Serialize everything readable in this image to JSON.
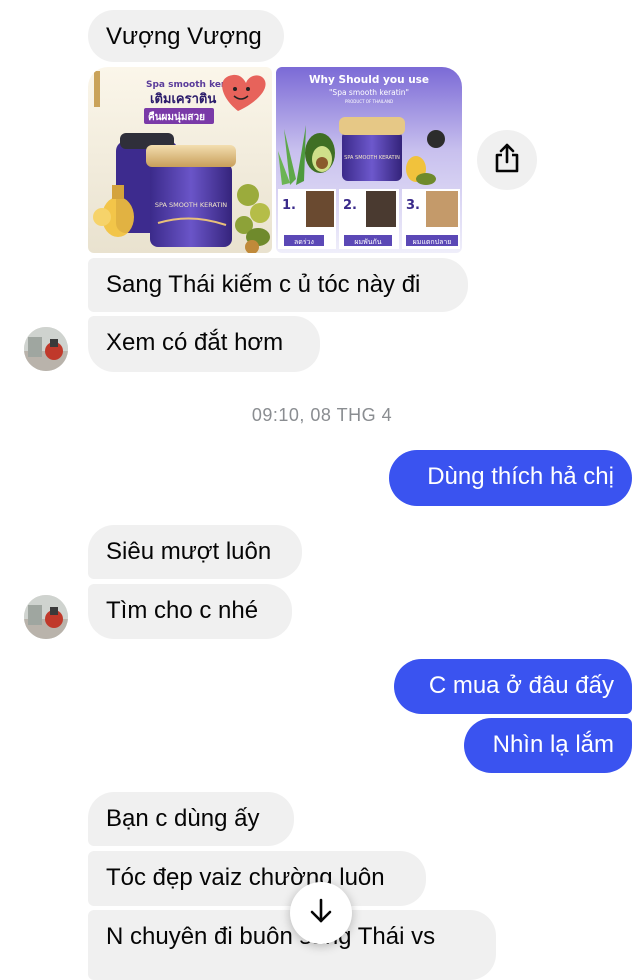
{
  "sender": {
    "name": "Vượng Vượng"
  },
  "images": {
    "left": {
      "headline": "Spa smooth keratin",
      "thai_line1": "เติมเคราติน",
      "thai_line2": "คืนผมนุ่มสวย",
      "jar_label": "SPA SMOOTH KERATIN"
    },
    "right": {
      "title": "Why Should you use",
      "subtitle": "\"Spa smooth keratin\"",
      "caption": "PRODUCT OF THAILAND",
      "steps": [
        {
          "number": "1.",
          "label": "ลดร่วง"
        },
        {
          "number": "2.",
          "label": "ผมพันกัน"
        },
        {
          "number": "3.",
          "label": "ผมแตกปลาย"
        }
      ]
    }
  },
  "messages": {
    "m1": "Sang Thái kiếm c ủ tóc này đi",
    "m2": "Xem có đắt hơm",
    "timestamp": "09:10, 08 THG 4",
    "m3": "Dùng thích hả chị",
    "m4": "Siêu mượt luôn",
    "m5": "Tìm cho c nhé",
    "m6": "C mua ở đâu đấy",
    "m7": "Nhìn lạ lắm",
    "m8": "Bạn c dùng ấy",
    "m9": "Tóc đẹp vaiz chường luôn",
    "m10": "N chuyên đi buôn sang Thái vs"
  },
  "colors": {
    "outgoing_bubble": "#3a53f0",
    "incoming_bubble": "#f0f0f0",
    "timestamp_text": "#8a8d91"
  },
  "icons": {
    "share": "share-icon",
    "scroll_down": "arrow-down-icon"
  }
}
